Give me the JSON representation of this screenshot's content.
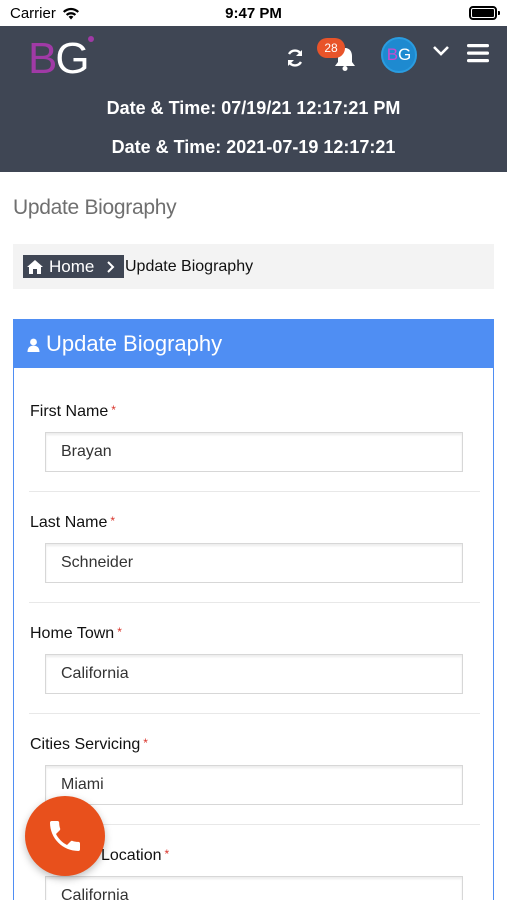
{
  "status_bar": {
    "carrier": "Carrier",
    "time": "9:47 PM"
  },
  "header": {
    "logo_b": "B",
    "logo_g": "G",
    "notification_count": "28",
    "avatar_initials_b": "B",
    "avatar_initials_g": "G",
    "datetime_line1": "Date & Time: 07/19/21 12:17:21 PM",
    "datetime_line2": "Date & Time: 2021-07-19 12:17:21"
  },
  "page": {
    "title": "Update Biography"
  },
  "breadcrumb": {
    "home": "Home",
    "current": "Update Biography"
  },
  "panel": {
    "title": "Update Biography"
  },
  "form": {
    "fields": [
      {
        "label": "First Name",
        "value": "Brayan",
        "required": "*"
      },
      {
        "label": "Last Name",
        "value": "Schneider",
        "required": "*"
      },
      {
        "label": "Home Town",
        "value": "California",
        "required": "*"
      },
      {
        "label": "Cities Servicing",
        "value": "Miami",
        "required": "*"
      },
      {
        "label": "Location",
        "value": "California",
        "required": "*"
      }
    ]
  },
  "colors": {
    "header_bg": "#3f4654",
    "accent_blue": "#4f8ef3",
    "call_button": "#e8501c",
    "badge": "#e8542a",
    "logo_purple": "#a03aa6"
  }
}
